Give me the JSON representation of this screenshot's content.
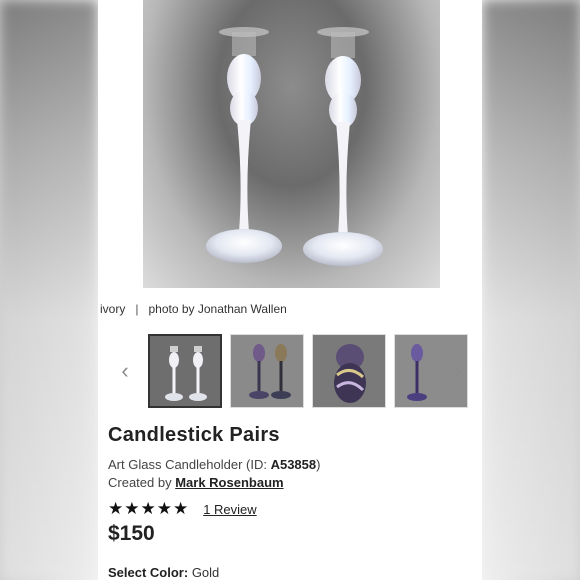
{
  "caption": {
    "left": "ivory",
    "right": "photo by Jonathan Wallen"
  },
  "carousel": {
    "prev_icon": "chevron-left-icon",
    "next_icon": "chevron-right-icon",
    "prev_glyph": "‹",
    "next_glyph": "›"
  },
  "product": {
    "title": "Candlestick Pairs",
    "subtitle_prefix": "Art Glass Candleholder (ID: ",
    "id": "A53858",
    "subtitle_suffix": ")",
    "created_by_label": "Created by ",
    "artist": "Mark Rosenbaum",
    "stars": "★★★★★",
    "reviews_link": "1 Review",
    "price": "$150",
    "color_label": "Select Color:",
    "color_value": "Gold"
  },
  "rating": {
    "value": 5,
    "max": 5
  }
}
